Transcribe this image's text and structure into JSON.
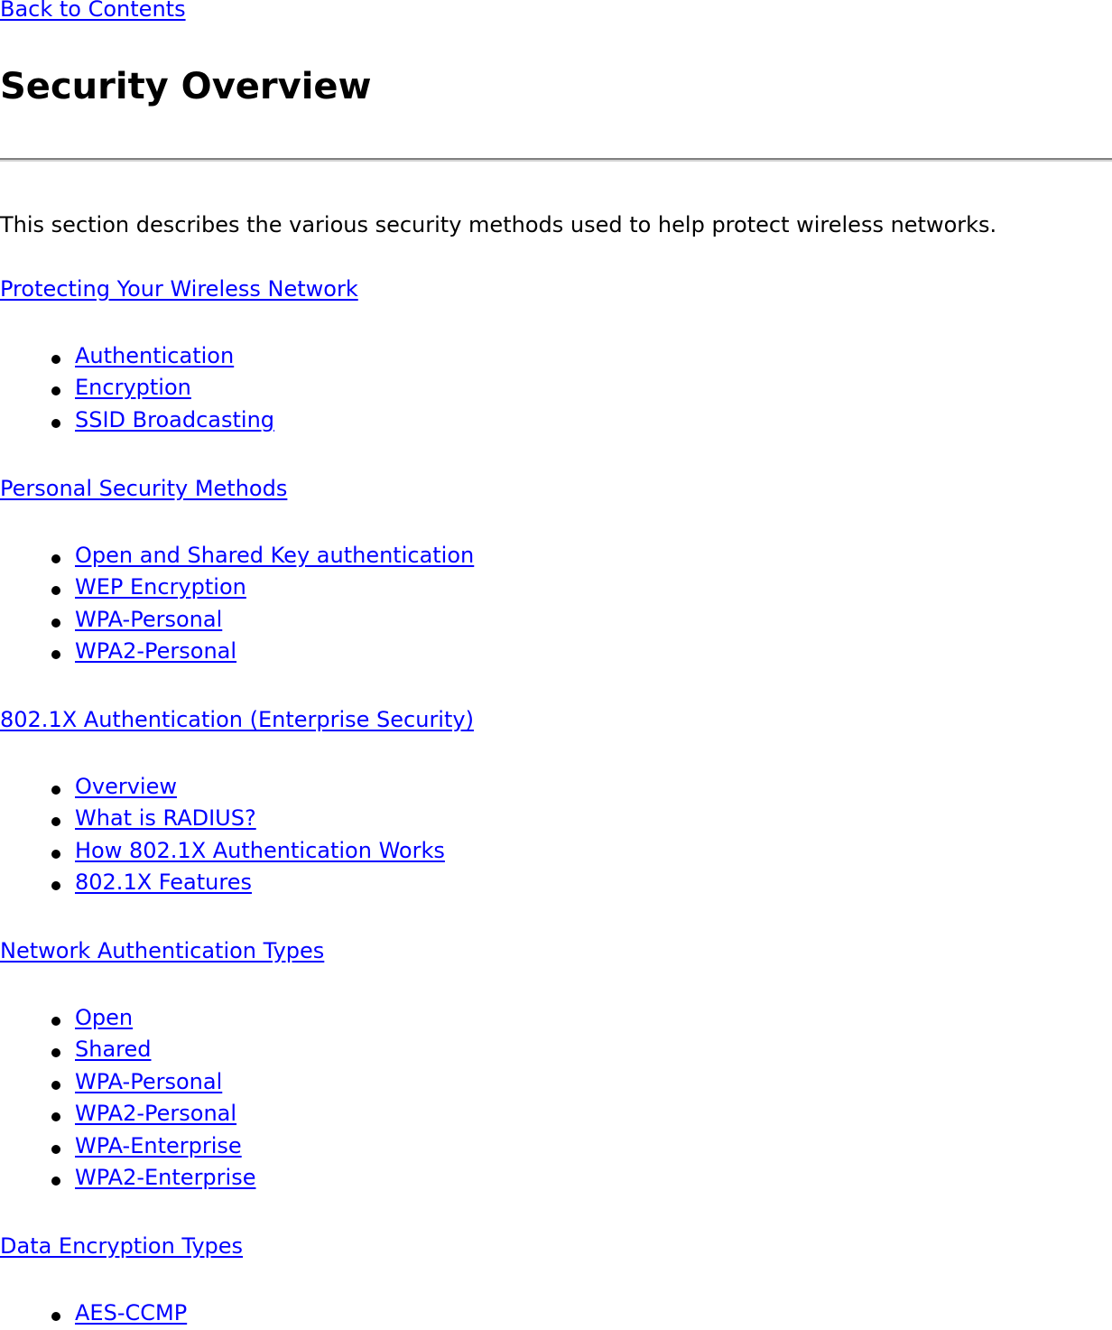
{
  "back_link": "Back to Contents",
  "title": "Security Overview",
  "intro": "This section describes the various security methods used to help protect wireless networks.",
  "sections": [
    {
      "heading": "Protecting Your Wireless Network",
      "items": [
        "Authentication",
        "Encryption",
        "SSID Broadcasting"
      ]
    },
    {
      "heading": "Personal Security Methods ",
      "items": [
        "Open and Shared Key authentication",
        "WEP Encryption",
        "WPA-Personal",
        "WPA2-Personal"
      ]
    },
    {
      "heading": "802.1X Authentication (Enterprise Security) ",
      "items": [
        "Overview",
        "What is RADIUS?",
        "How 802.1X Authentication Works",
        "802.1X Features"
      ]
    },
    {
      "heading": "Network Authentication Types ",
      "items": [
        "Open",
        "Shared",
        "WPA-Personal ",
        "WPA2-Personal ",
        "WPA-Enterprise",
        "WPA2-Enterprise"
      ]
    },
    {
      "heading": "Data Encryption Types ",
      "items": [
        "AES-CCMP"
      ]
    }
  ]
}
